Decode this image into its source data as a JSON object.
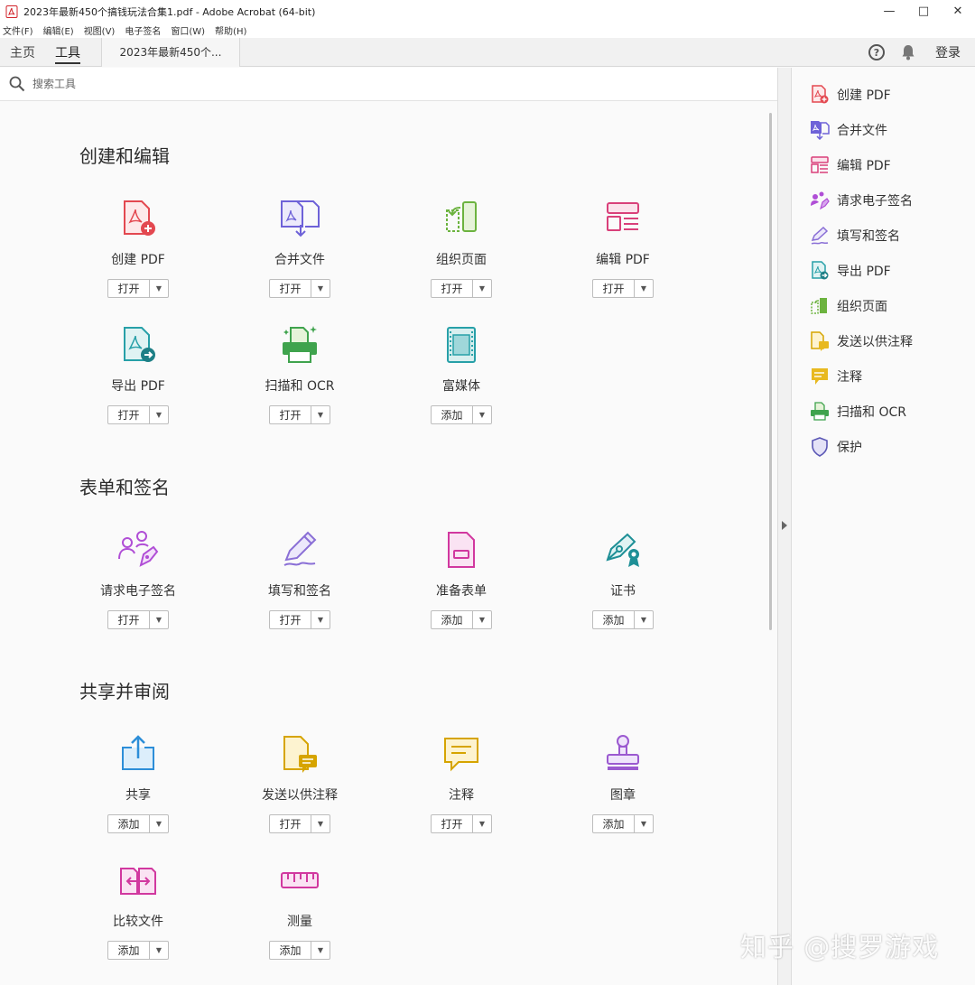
{
  "window": {
    "title": "2023年最新450个搞钱玩法合集1.pdf - Adobe Acrobat (64-bit)"
  },
  "menu": [
    "文件(F)",
    "编辑(E)",
    "视图(V)",
    "电子签名",
    "窗口(W)",
    "帮助(H)"
  ],
  "tabs": {
    "home": "主页",
    "tools": "工具",
    "document": "2023年最新450个..."
  },
  "header": {
    "login": "登录"
  },
  "search": {
    "placeholder": "搜索工具"
  },
  "sections": [
    {
      "title": "创建和编辑",
      "tools": [
        {
          "label": "创建 PDF",
          "button": "打开",
          "icon": "create-pdf-icon"
        },
        {
          "label": "合并文件",
          "button": "打开",
          "icon": "combine-files-icon"
        },
        {
          "label": "组织页面",
          "button": "打开",
          "icon": "organize-pages-icon"
        },
        {
          "label": "编辑 PDF",
          "button": "打开",
          "icon": "edit-pdf-icon"
        },
        {
          "label": "导出 PDF",
          "button": "打开",
          "icon": "export-pdf-icon"
        },
        {
          "label": "扫描和 OCR",
          "button": "打开",
          "icon": "scan-ocr-icon"
        },
        {
          "label": "富媒体",
          "button": "添加",
          "icon": "rich-media-icon"
        }
      ]
    },
    {
      "title": "表单和签名",
      "tools": [
        {
          "label": "请求电子签名",
          "button": "打开",
          "icon": "request-esign-icon"
        },
        {
          "label": "填写和签名",
          "button": "打开",
          "icon": "fill-sign-icon"
        },
        {
          "label": "准备表单",
          "button": "添加",
          "icon": "prepare-form-icon"
        },
        {
          "label": "证书",
          "button": "添加",
          "icon": "certificate-icon"
        }
      ]
    },
    {
      "title": "共享并审阅",
      "tools": [
        {
          "label": "共享",
          "button": "添加",
          "icon": "share-icon"
        },
        {
          "label": "发送以供注释",
          "button": "打开",
          "icon": "send-comment-icon"
        },
        {
          "label": "注释",
          "button": "打开",
          "icon": "comment-icon"
        },
        {
          "label": "图章",
          "button": "添加",
          "icon": "stamp-icon"
        },
        {
          "label": "比较文件",
          "button": "添加",
          "icon": "compare-files-icon"
        },
        {
          "label": "测量",
          "button": "添加",
          "icon": "measure-icon"
        }
      ]
    }
  ],
  "right_panel": [
    {
      "label": "创建 PDF",
      "icon": "create-pdf-icon"
    },
    {
      "label": "合并文件",
      "icon": "combine-files-icon"
    },
    {
      "label": "编辑 PDF",
      "icon": "edit-pdf-icon"
    },
    {
      "label": "请求电子签名",
      "icon": "request-esign-icon"
    },
    {
      "label": "填写和签名",
      "icon": "fill-sign-icon"
    },
    {
      "label": "导出 PDF",
      "icon": "export-pdf-icon"
    },
    {
      "label": "组织页面",
      "icon": "organize-pages-icon"
    },
    {
      "label": "发送以供注释",
      "icon": "send-comment-icon"
    },
    {
      "label": "注释",
      "icon": "comment-icon"
    },
    {
      "label": "扫描和 OCR",
      "icon": "scan-ocr-icon"
    },
    {
      "label": "保护",
      "icon": "protect-icon"
    }
  ],
  "watermark": "知乎 @搜罗游戏",
  "colors": {
    "red": "#e34850",
    "purple": "#6e62d8",
    "green": "#6cb33f",
    "pink": "#d9407a",
    "teal": "#27a0a8",
    "yellow": "#e8b920",
    "blue": "#2d8ed8",
    "violet": "#b04ed6",
    "magenta": "#d1389f"
  }
}
